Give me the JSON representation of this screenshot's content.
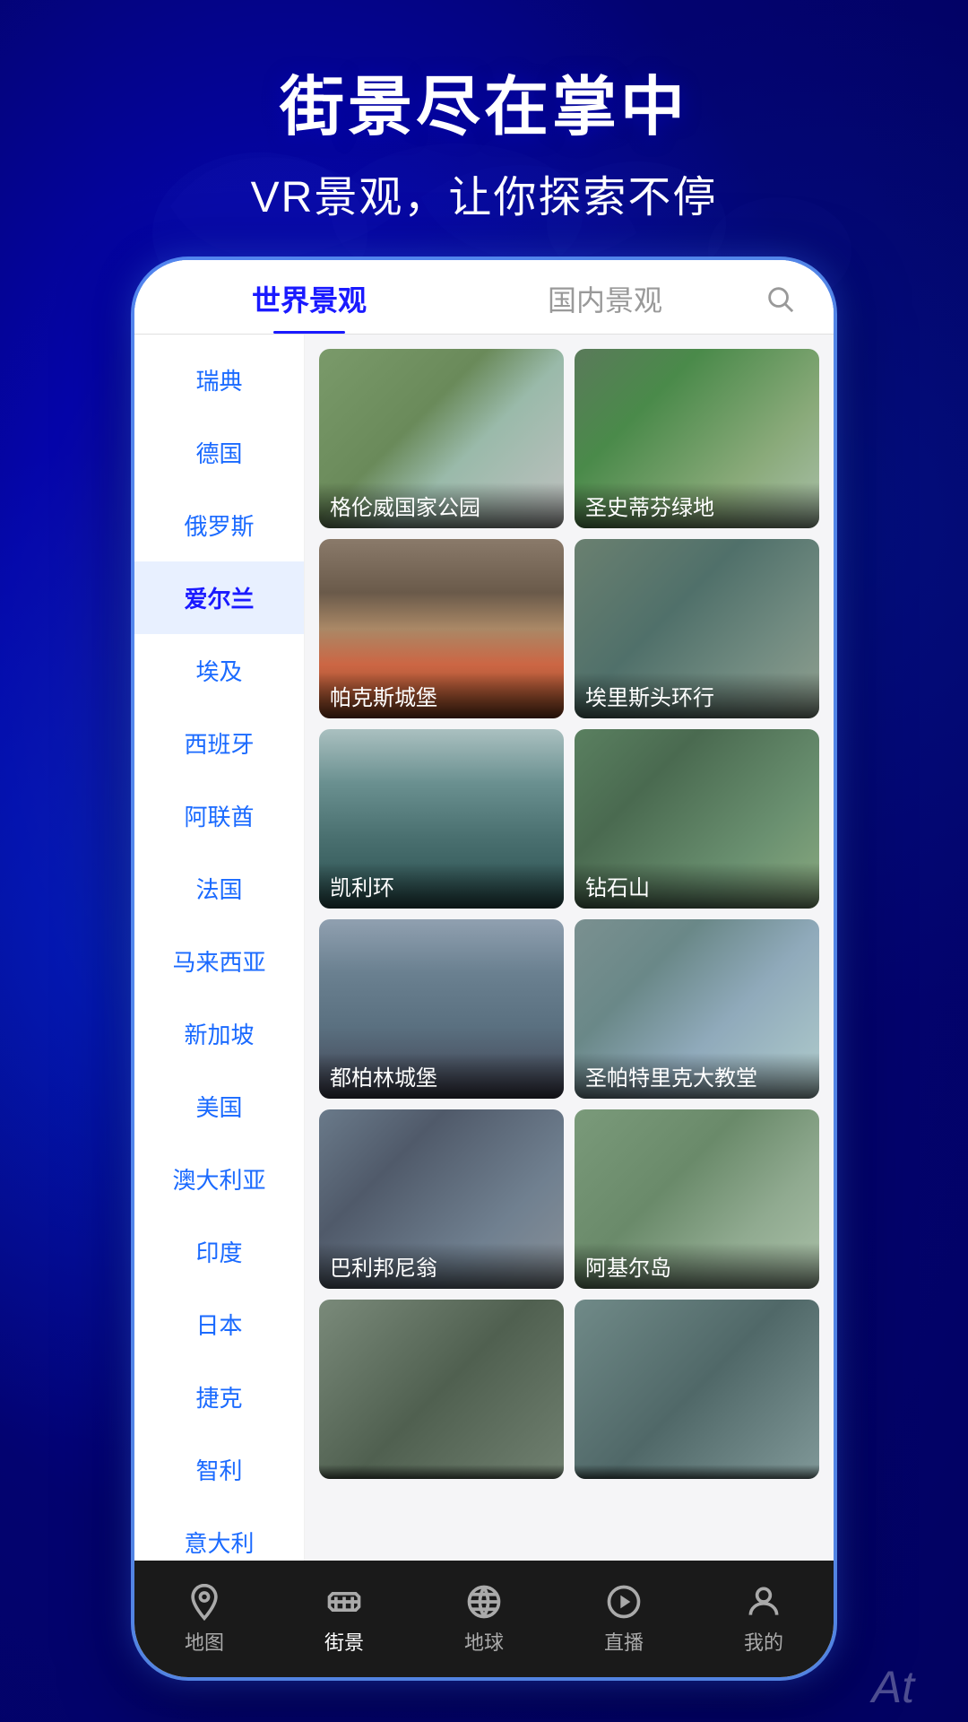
{
  "hero": {
    "title": "街景尽在掌中",
    "subtitle": "VR景观，让你探索不停"
  },
  "tabs": {
    "world": "世界景观",
    "domestic": "国内景观"
  },
  "countries": [
    {
      "label": "瑞典",
      "active": false
    },
    {
      "label": "德国",
      "active": false
    },
    {
      "label": "俄罗斯",
      "active": false
    },
    {
      "label": "爱尔兰",
      "active": true
    },
    {
      "label": "埃及",
      "active": false
    },
    {
      "label": "西班牙",
      "active": false
    },
    {
      "label": "阿联酋",
      "active": false
    },
    {
      "label": "法国",
      "active": false
    },
    {
      "label": "马来西亚",
      "active": false
    },
    {
      "label": "新加坡",
      "active": false
    },
    {
      "label": "美国",
      "active": false
    },
    {
      "label": "澳大利亚",
      "active": false
    },
    {
      "label": "印度",
      "active": false
    },
    {
      "label": "日本",
      "active": false
    },
    {
      "label": "捷克",
      "active": false
    },
    {
      "label": "智利",
      "active": false
    },
    {
      "label": "意大利",
      "active": false
    }
  ],
  "cards": [
    {
      "label": "格伦威国家公园",
      "colorClass": "card-1"
    },
    {
      "label": "圣史蒂芬绿地",
      "colorClass": "card-2"
    },
    {
      "label": "帕克斯城堡",
      "colorClass": "card-3"
    },
    {
      "label": "埃里斯头环行",
      "colorClass": "card-4"
    },
    {
      "label": "凯利环",
      "colorClass": "card-5"
    },
    {
      "label": "钻石山",
      "colorClass": "card-6"
    },
    {
      "label": "都柏林城堡",
      "colorClass": "card-7"
    },
    {
      "label": "圣帕特里克大教堂",
      "colorClass": "card-8"
    },
    {
      "label": "巴利邦尼翁",
      "colorClass": "card-9"
    },
    {
      "label": "阿基尔岛",
      "colorClass": "card-10"
    }
  ],
  "nav": {
    "items": [
      {
        "label": "地图",
        "icon": "map"
      },
      {
        "label": "街景",
        "icon": "street"
      },
      {
        "label": "地球",
        "icon": "globe"
      },
      {
        "label": "直播",
        "icon": "play"
      },
      {
        "label": "我的",
        "icon": "user"
      }
    ],
    "activeIndex": 1
  },
  "bottom_at": "At"
}
